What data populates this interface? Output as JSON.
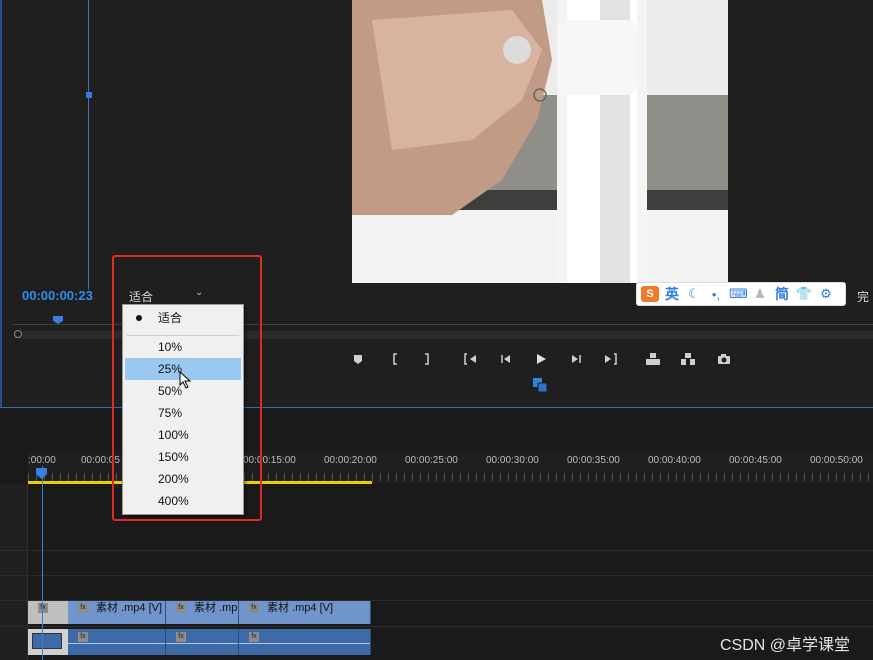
{
  "monitor": {
    "timecode": "00:00:00:23",
    "fit_value": "适合",
    "partial_label": "完"
  },
  "dropdown": {
    "checked_label": "适合",
    "options": [
      "10%",
      "25%",
      "50%",
      "75%",
      "100%",
      "150%",
      "200%",
      "400%"
    ],
    "hovered": "25%"
  },
  "ime": {
    "lang": "英",
    "simplified": "简",
    "icons": [
      "sogou-logo",
      "moon-icon",
      "punctuation-icon",
      "keyboard-icon",
      "user-icon",
      "shirt-icon",
      "gear-icon"
    ]
  },
  "timeline": {
    "ruler_labels": [
      ":00:00",
      "00:00:05",
      "00:00:15:00",
      "00:00:20:00",
      "00:00:25:00",
      "00:00:30:00",
      "00:00:35:00",
      "00:00:40:00",
      "00:00:45:00",
      "00:00:50:00"
    ],
    "clips": [
      "素材 .mp4 [V]",
      "素材 .mp",
      "素材 .mp4 [V]"
    ]
  },
  "watermark": "CSDN @卓学课堂",
  "colors": {
    "accent": "#2f8fe8",
    "highlight_box": "#e12a23",
    "work_area": "#e8d000",
    "clip": "#6f95cc"
  }
}
